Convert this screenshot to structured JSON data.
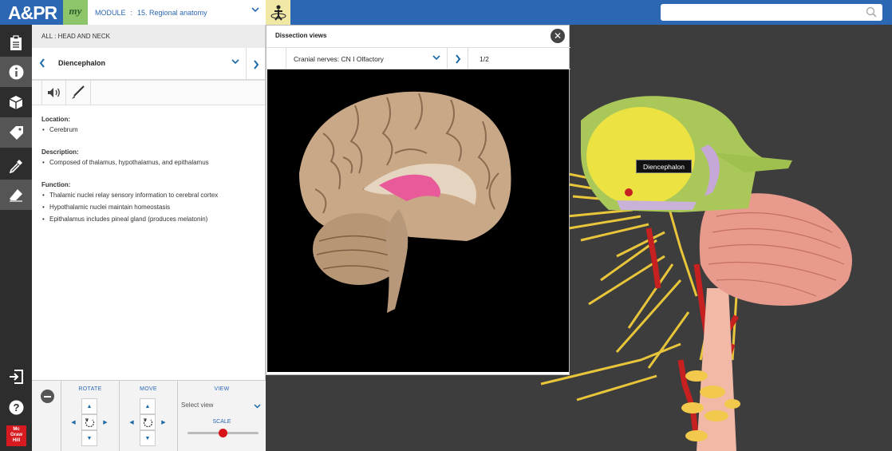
{
  "app": {
    "logo": "A&PR",
    "my_badge": "my"
  },
  "module": {
    "label": "MODULE",
    "value": "15. Regional anatomy"
  },
  "search": {
    "placeholder": ""
  },
  "panel": {
    "breadcrumb": "ALL : HEAD AND NECK",
    "structure_name": "Diencephalon",
    "sections": [
      {
        "heading": "Location:",
        "items": [
          "Cerebrum"
        ]
      },
      {
        "heading": "Description:",
        "items": [
          "Composed of thalamus, hypothalamus, and epithalamus"
        ]
      },
      {
        "heading": "Function:",
        "items": [
          "Thalamic nuclei relay sensory information to cerebral cortex",
          "Hypothalamic nuclei maintain homeostasis",
          "Epithalamus includes pineal gland (produces melatonin)"
        ]
      }
    ]
  },
  "controls": {
    "rotate_label": "ROTATE",
    "move_label": "MOVE",
    "view_label": "VIEW",
    "select_view": "Select view",
    "scale_label": "SCALE",
    "scale_value": 0.5
  },
  "modal": {
    "title": "Dissection views",
    "view_select": "Cranial nerves: CN I Olfactory",
    "page": "1/2"
  },
  "viewer": {
    "tooltip": "Diencephalon"
  },
  "rail": {
    "icons": [
      "clipboard-icon",
      "info-icon",
      "cube-icon",
      "tag-icon",
      "dropper-icon",
      "eraser-icon",
      "exit-icon",
      "help-icon"
    ]
  },
  "publisher": {
    "logo_lines": [
      "Mc",
      "Graw",
      "Hill"
    ]
  },
  "colors": {
    "brand_blue": "#2b67b3",
    "accent_green": "#8cc56a",
    "slider_red": "#d7141a",
    "highlight_pink": "#e85a9a"
  }
}
